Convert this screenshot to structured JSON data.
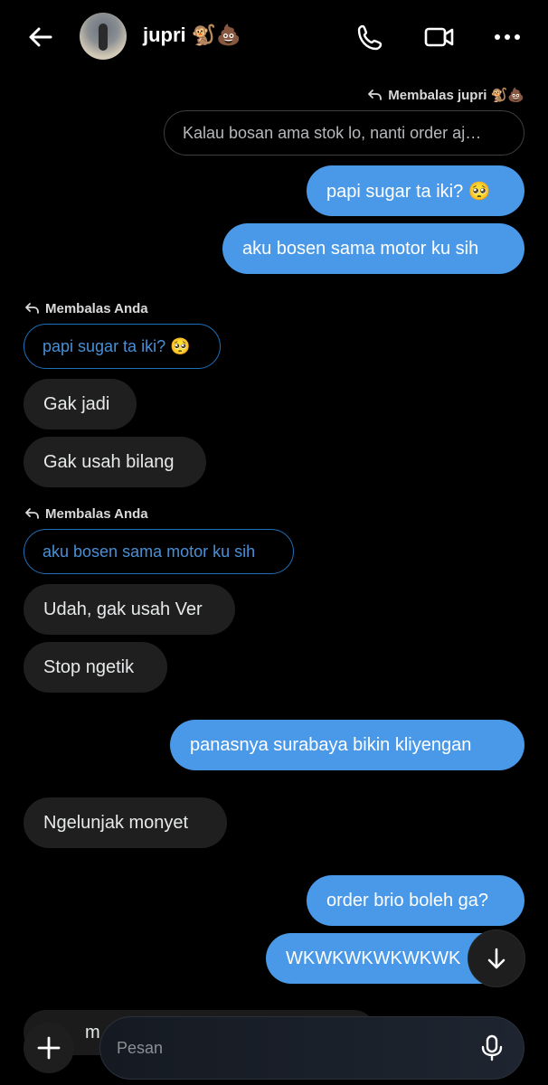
{
  "header": {
    "title": "jupri 🐒💩",
    "icons": [
      "back-arrow-icon",
      "phone-icon",
      "video-icon",
      "more-icon"
    ]
  },
  "messages": [
    {
      "type": "reply_header",
      "text": "Membalas jupri 🐒💩",
      "side": "out"
    },
    {
      "type": "quote",
      "text": "Kalau bosan ama stok lo, nanti order aj…",
      "side": "out"
    },
    {
      "type": "bubble",
      "text": "papi sugar ta iki? 🥺",
      "side": "out"
    },
    {
      "type": "bubble",
      "text": "aku bosen sama motor ku sih",
      "side": "out"
    },
    {
      "type": "reply_header",
      "text": "Membalas Anda",
      "side": "in"
    },
    {
      "type": "quote",
      "text": "papi sugar ta iki? 🥺",
      "side": "in"
    },
    {
      "type": "bubble",
      "text": "Gak jadi",
      "side": "in"
    },
    {
      "type": "bubble",
      "text": "Gak usah bilang",
      "side": "in"
    },
    {
      "type": "reply_header",
      "text": "Membalas Anda",
      "side": "in"
    },
    {
      "type": "quote",
      "text": "aku bosen sama motor ku sih",
      "side": "in"
    },
    {
      "type": "bubble",
      "text": "Udah, gak usah Ver",
      "side": "in"
    },
    {
      "type": "bubble",
      "text": "Stop ngetik",
      "side": "in"
    },
    {
      "type": "bubble",
      "text": "panasnya surabaya bikin kliyengan",
      "side": "out"
    },
    {
      "type": "bubble",
      "text": "Ngelunjak monyet",
      "side": "in"
    },
    {
      "type": "bubble",
      "text": "order brio boleh ga?",
      "side": "out"
    },
    {
      "type": "bubble",
      "text": "WKWKWKWKWKWK",
      "side": "out"
    },
    {
      "type": "bubble",
      "text": "m",
      "side": "in",
      "partial": true
    }
  ],
  "composer": {
    "placeholder": "Pesan"
  },
  "colors": {
    "outgoing": "#4a99e9",
    "incoming": "#1f1f1f",
    "quote_in_border": "#1d6fb8",
    "background": "#000000"
  }
}
